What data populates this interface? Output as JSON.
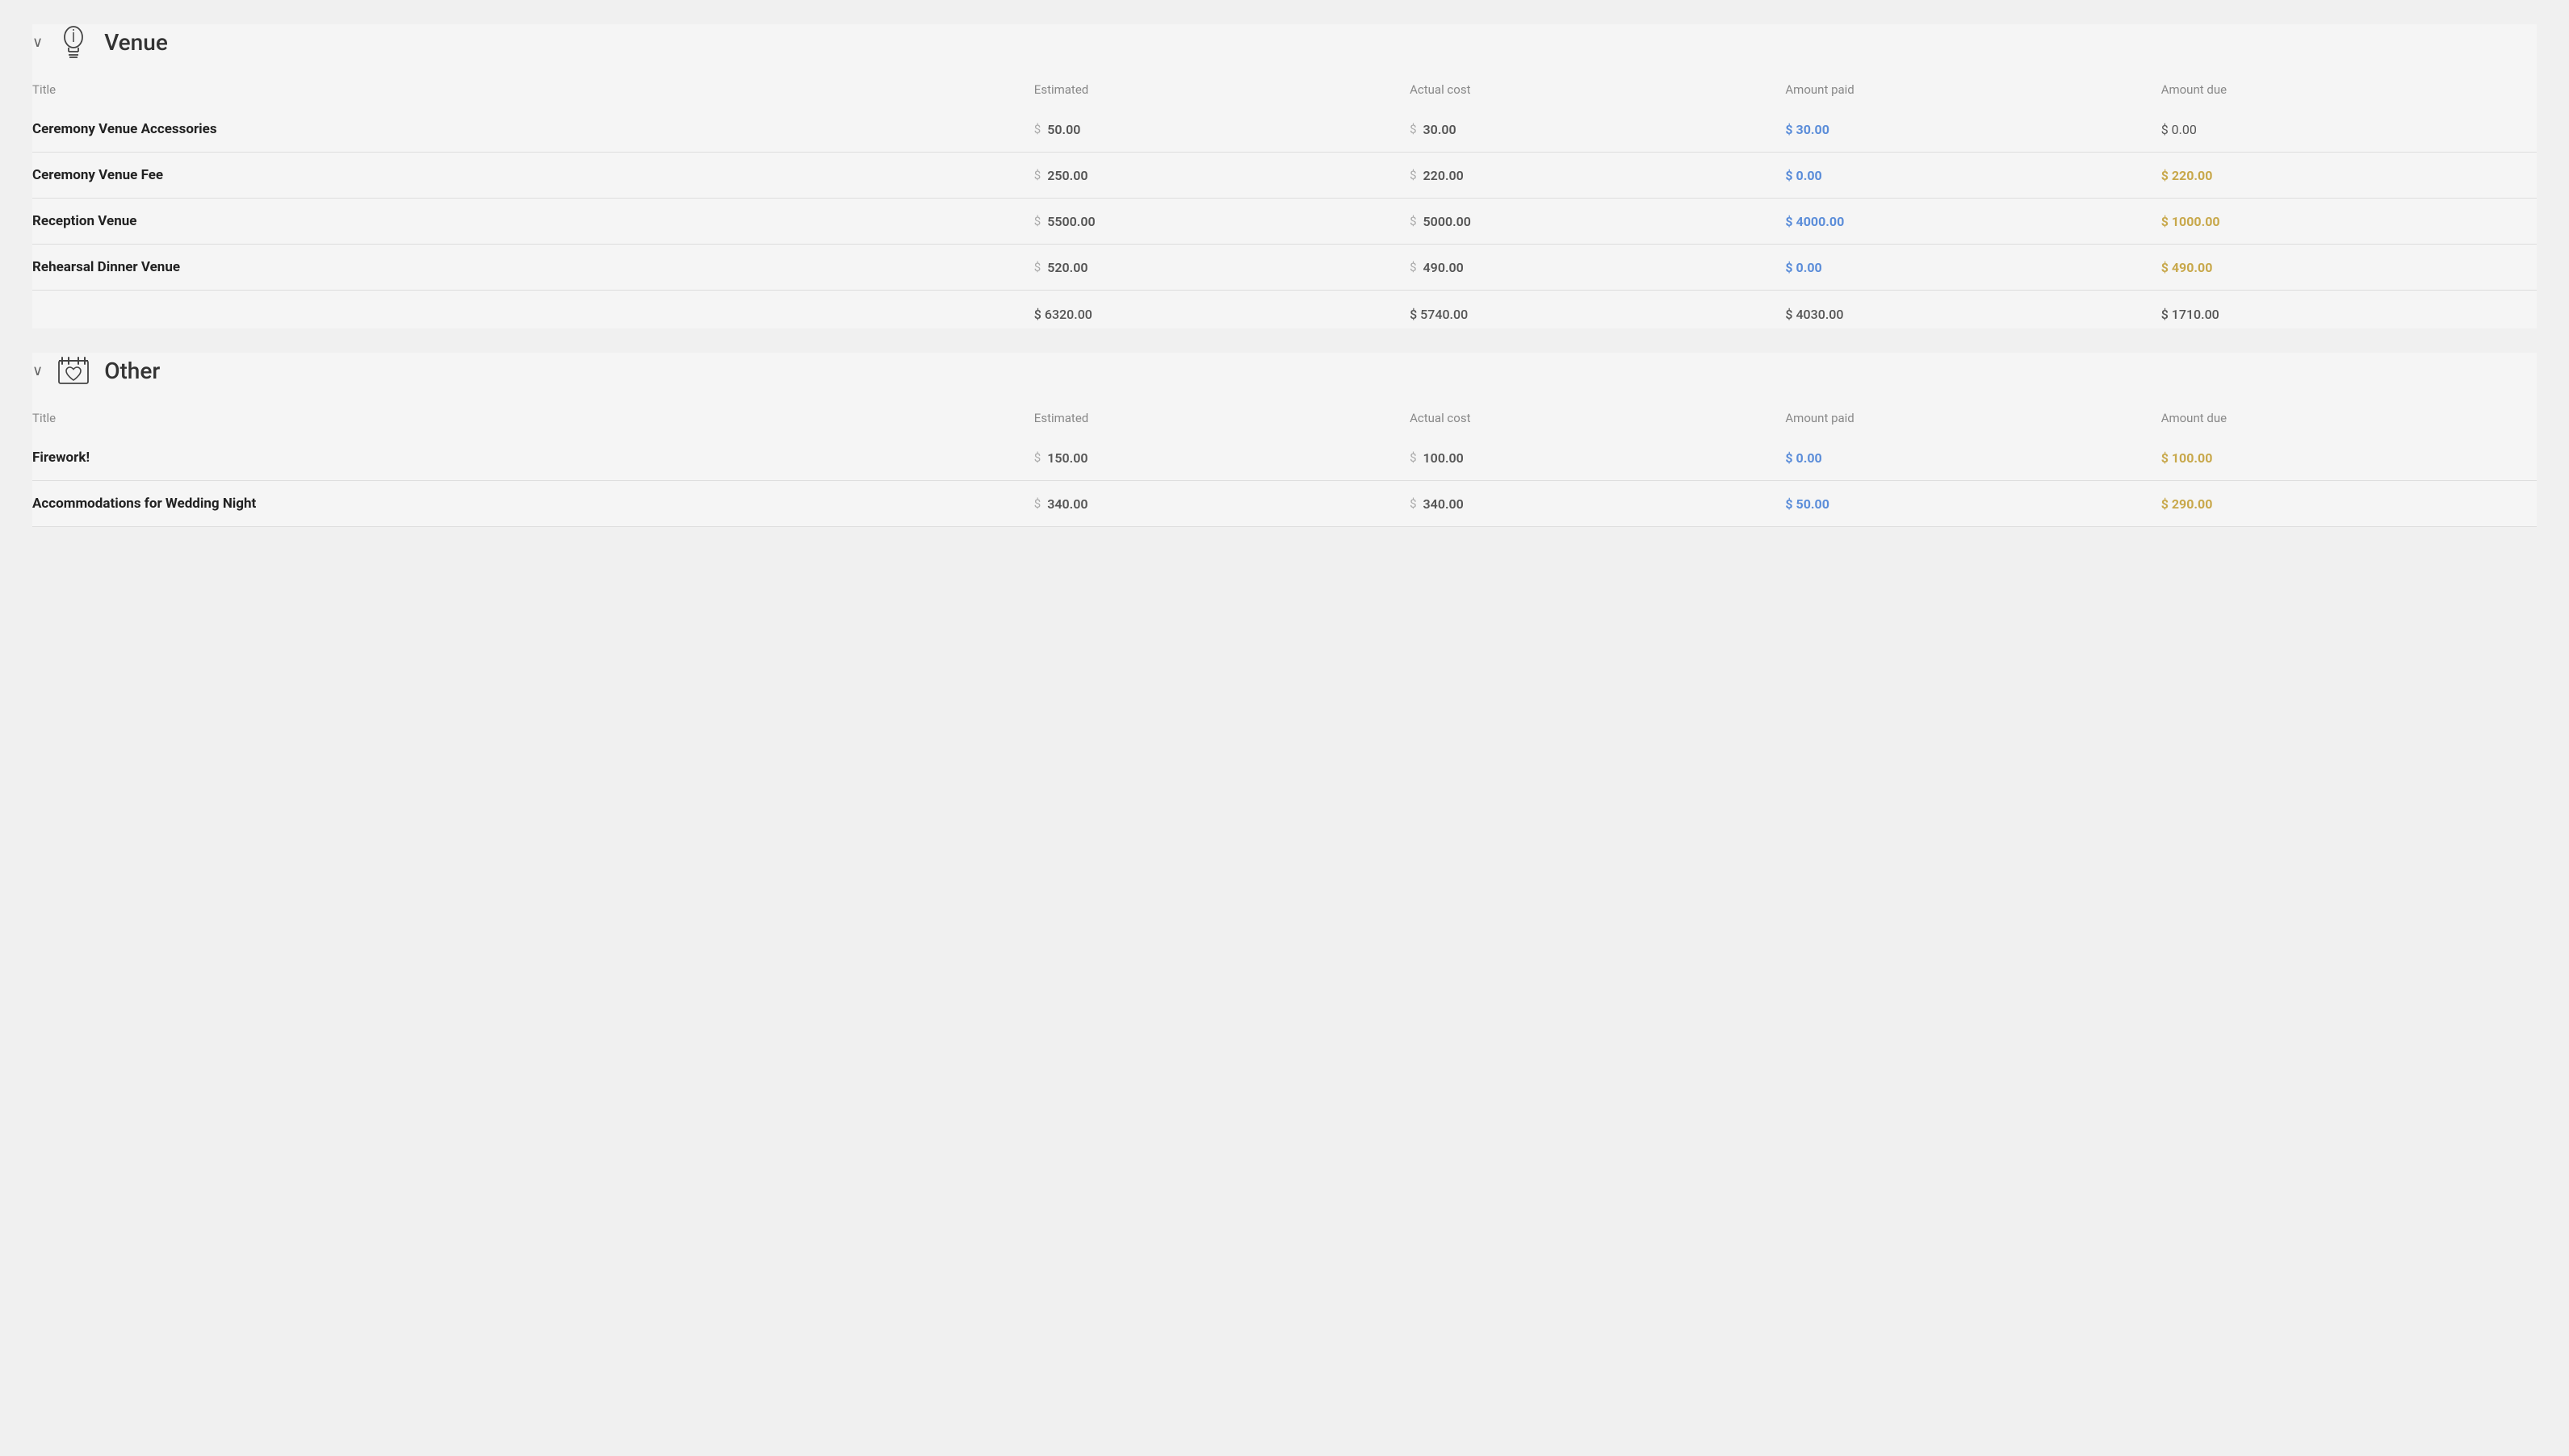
{
  "sections": [
    {
      "id": "venue",
      "title": "Venue",
      "icon": "lightbulb",
      "columns": {
        "title": "Title",
        "estimated": "Estimated",
        "actual": "Actual cost",
        "paid": "Amount paid",
        "due": "Amount due"
      },
      "items": [
        {
          "title": "Ceremony Venue Accessories",
          "estimated": "50.00",
          "actual": "30.00",
          "paid": "30.00",
          "due": "0.00",
          "paid_nonzero": true,
          "due_nonzero": false
        },
        {
          "title": "Ceremony Venue Fee",
          "estimated": "250.00",
          "actual": "220.00",
          "paid": "0.00",
          "due": "220.00",
          "paid_nonzero": false,
          "due_nonzero": true
        },
        {
          "title": "Reception Venue",
          "estimated": "5500.00",
          "actual": "5000.00",
          "paid": "4000.00",
          "due": "1000.00",
          "paid_nonzero": true,
          "due_nonzero": true
        },
        {
          "title": "Rehearsal Dinner Venue",
          "estimated": "520.00",
          "actual": "490.00",
          "paid": "0.00",
          "due": "490.00",
          "paid_nonzero": false,
          "due_nonzero": true
        }
      ],
      "totals": {
        "estimated": "$ 6320.00",
        "actual": "$ 5740.00",
        "paid": "$ 4030.00",
        "due": "$ 1710.00"
      }
    },
    {
      "id": "other",
      "title": "Other",
      "icon": "heart-box",
      "columns": {
        "title": "Title",
        "estimated": "Estimated",
        "actual": "Actual cost",
        "paid": "Amount paid",
        "due": "Amount due"
      },
      "items": [
        {
          "title": "Firework!",
          "estimated": "150.00",
          "actual": "100.00",
          "paid": "0.00",
          "due": "100.00",
          "paid_nonzero": false,
          "due_nonzero": true
        },
        {
          "title": "Accommodations for Wedding Night",
          "estimated": "340.00",
          "actual": "340.00",
          "paid": "50.00",
          "due": "290.00",
          "paid_nonzero": true,
          "due_nonzero": true
        }
      ],
      "totals": null
    }
  ],
  "ui": {
    "chevron": "∨",
    "dollar": "$"
  }
}
